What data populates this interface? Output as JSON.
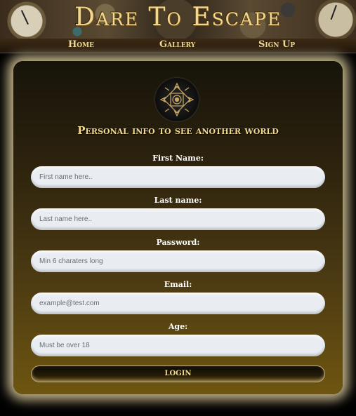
{
  "header": {
    "title": "Dare To Escape"
  },
  "nav": {
    "items": [
      {
        "label": "Home"
      },
      {
        "label": "Gallery"
      },
      {
        "label": "Sign Up"
      }
    ]
  },
  "form": {
    "heading": "Personal info to see another world",
    "fields": [
      {
        "label": "First Name:",
        "placeholder": "First name here.."
      },
      {
        "label": "Last name:",
        "placeholder": "Last name here.."
      },
      {
        "label": "Password:",
        "placeholder": "Min 6 charaters long"
      },
      {
        "label": "Email:",
        "placeholder": "example@test.com"
      },
      {
        "label": "Age:",
        "placeholder": "Must be over 18"
      }
    ],
    "submit_label": "LOGIN"
  },
  "colors": {
    "accent_gold": "#f1d991",
    "card_top": "#17140a",
    "card_bottom": "#6e5510",
    "glow": "#e8d6a5"
  },
  "icons": {
    "logo": "ornate-medallion-icon"
  }
}
